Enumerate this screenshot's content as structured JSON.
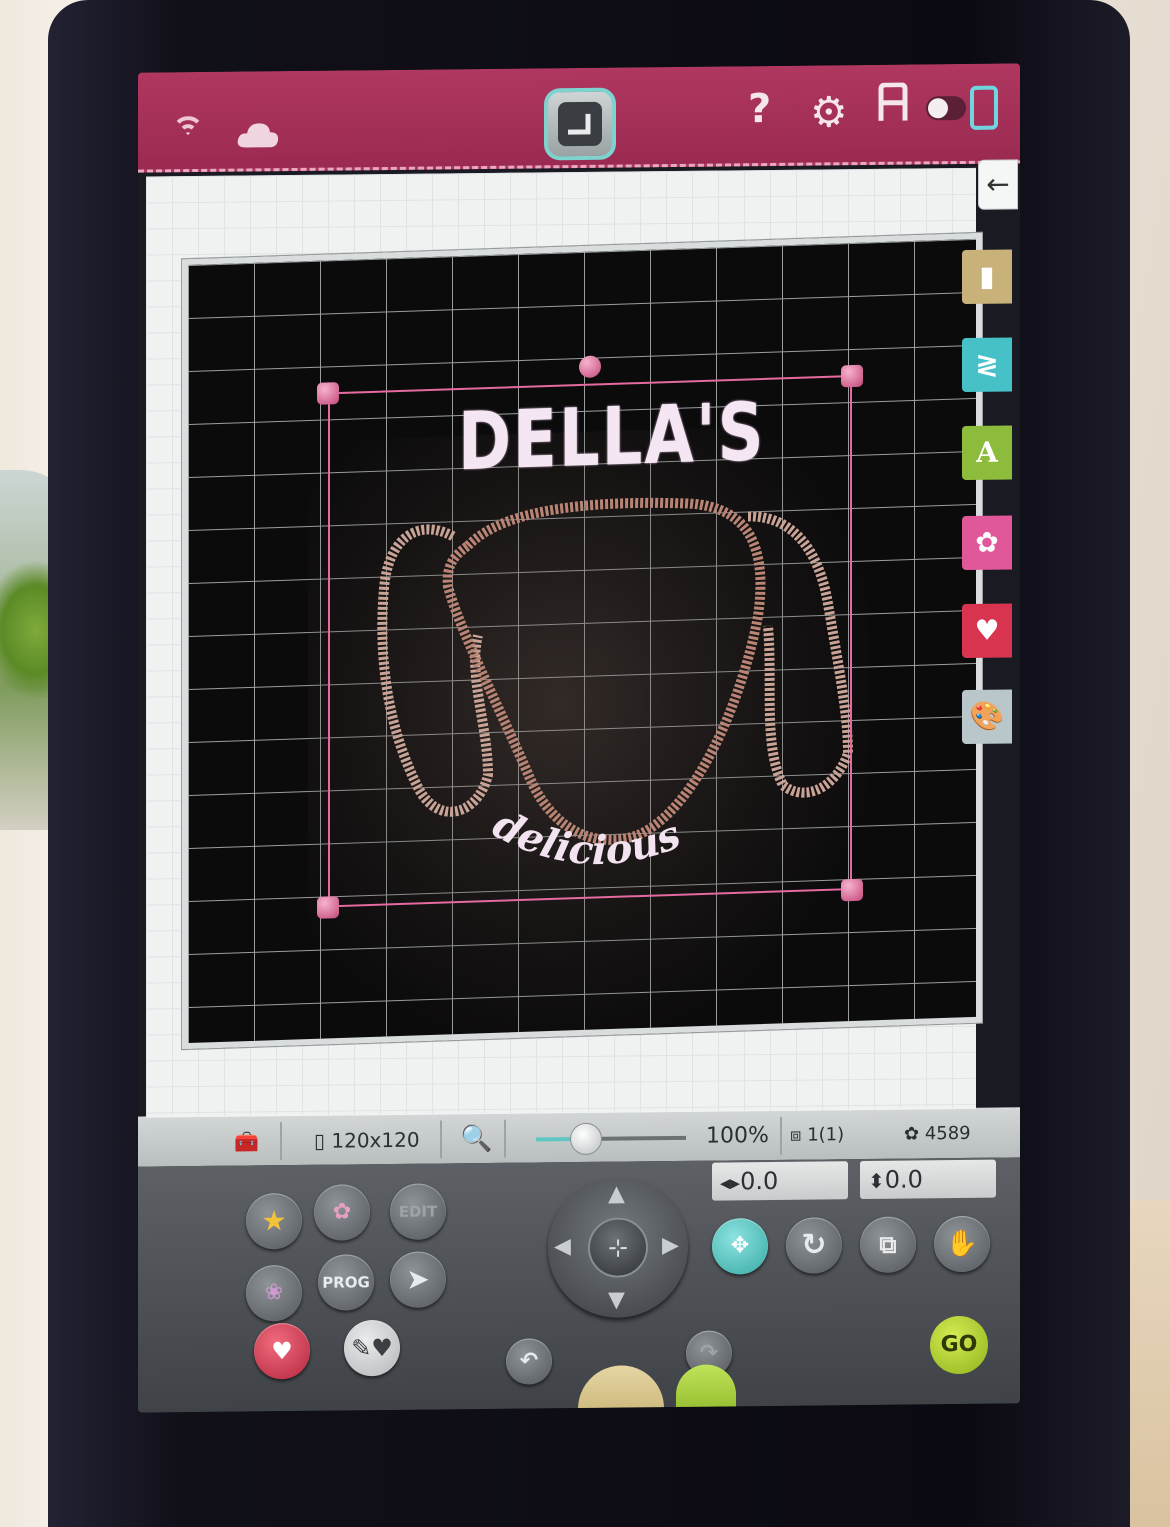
{
  "design": {
    "title_text": "DELLA'S",
    "script_text": "delicious"
  },
  "info_bar": {
    "hoop_size": "120x120",
    "zoom": "100%",
    "design_count": "1(1)",
    "stitch_count": "4589"
  },
  "position": {
    "x": "0.0",
    "y": "0.0"
  },
  "buttons": {
    "edit_label": "EDIT",
    "prog_label": "PROG",
    "go_label": "GO",
    "help_label": "?"
  },
  "side_tabs": [
    {
      "icon": "folder-icon",
      "color": "#c8b27a"
    },
    {
      "icon": "stitch-icon",
      "color": "#46c1c8"
    },
    {
      "icon": "font-icon",
      "label": "A",
      "color": "#8dbb3c"
    },
    {
      "icon": "flower-icon",
      "color": "#e0579a"
    },
    {
      "icon": "heart-folder-icon",
      "color": "#d8344f"
    },
    {
      "icon": "palette-icon",
      "color": "#b9c7cb"
    }
  ],
  "colors": {
    "title_bar": "#a3305a",
    "accent_teal": "#5ec7c4",
    "go_green": "#b6d531",
    "selection_pink": "#e46aa0"
  }
}
